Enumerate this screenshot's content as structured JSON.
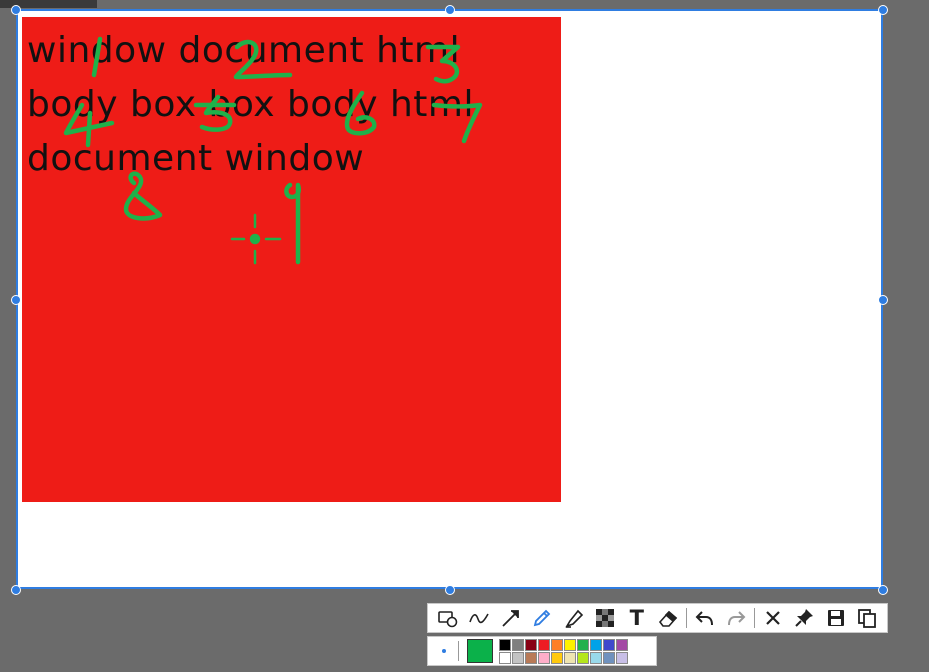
{
  "canvas": {
    "lines": [
      "window document html",
      "body box box body html",
      "document window"
    ],
    "background_color": "#ee1c17",
    "annotation_color": "#1fb14a",
    "annotation_numbers": [
      "1",
      "2",
      "3",
      "4",
      "5",
      "6",
      "7",
      "8",
      "9"
    ]
  },
  "selection": {
    "border_color": "#2f7de1"
  },
  "toolbar": {
    "tools": [
      {
        "name": "rectangle-ellipse-tool",
        "icon": "shapes-icon"
      },
      {
        "name": "curve-tool",
        "icon": "curve-icon"
      },
      {
        "name": "arrow-tool",
        "icon": "arrow-icon"
      },
      {
        "name": "pen-tool",
        "icon": "pencil-icon",
        "active": true
      },
      {
        "name": "highlighter-tool",
        "icon": "highlighter-icon"
      },
      {
        "name": "mosaic-tool",
        "icon": "mosaic-icon"
      },
      {
        "name": "text-tool",
        "icon": "text-icon"
      },
      {
        "name": "eraser-tool",
        "icon": "eraser-icon"
      },
      {
        "name": "undo-button",
        "icon": "undo-icon"
      },
      {
        "name": "redo-button",
        "icon": "redo-icon"
      },
      {
        "name": "cancel-button",
        "icon": "close-icon"
      },
      {
        "name": "pin-button",
        "icon": "pin-icon"
      },
      {
        "name": "save-button",
        "icon": "save-icon"
      },
      {
        "name": "copy-button",
        "icon": "copy-icon"
      }
    ],
    "text_tool_glyph": "T"
  },
  "colors": {
    "current": "#0bb14a",
    "palette": [
      "#000000",
      "#7f7f7f",
      "#880015",
      "#ed1c24",
      "#ff7f27",
      "#fff200",
      "#22b14c",
      "#00a2e8",
      "#3f48cc",
      "#a349a4",
      "#ffffff",
      "#c3c3c3",
      "#b97a57",
      "#ffaec9",
      "#ffc90e",
      "#efe4b0",
      "#b5e61d",
      "#99d9ea",
      "#7092be",
      "#c8bfe7"
    ]
  }
}
